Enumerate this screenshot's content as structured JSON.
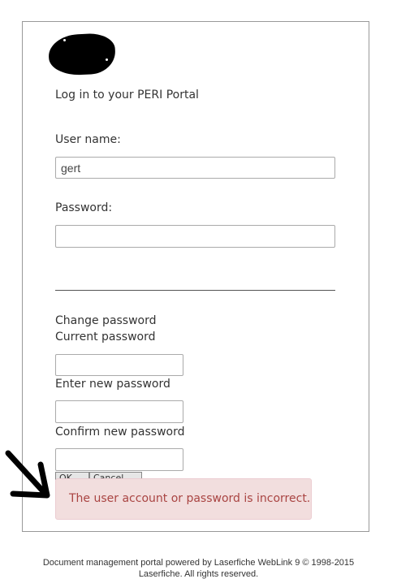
{
  "login": {
    "heading": "Log in to your PERI Portal",
    "username_label": "User name:",
    "username_value": "gert",
    "password_label": "Password:",
    "password_value": ""
  },
  "change_password": {
    "title": "Change password",
    "current_label": "Current password",
    "new_label": "Enter new password",
    "confirm_label": "Confirm new password",
    "ok_label": "OK",
    "cancel_label": "Cancel"
  },
  "alert": {
    "message": "The user account or password is incorrect."
  },
  "footer": {
    "line1": "Document management portal powered by Laserfiche WebLink 9 © 1998-2015",
    "line2": "Laserfiche. All rights reserved."
  },
  "colors": {
    "alert_bg": "#f2dede",
    "alert_text": "#a94442",
    "alert_border": "#ebccd1"
  }
}
